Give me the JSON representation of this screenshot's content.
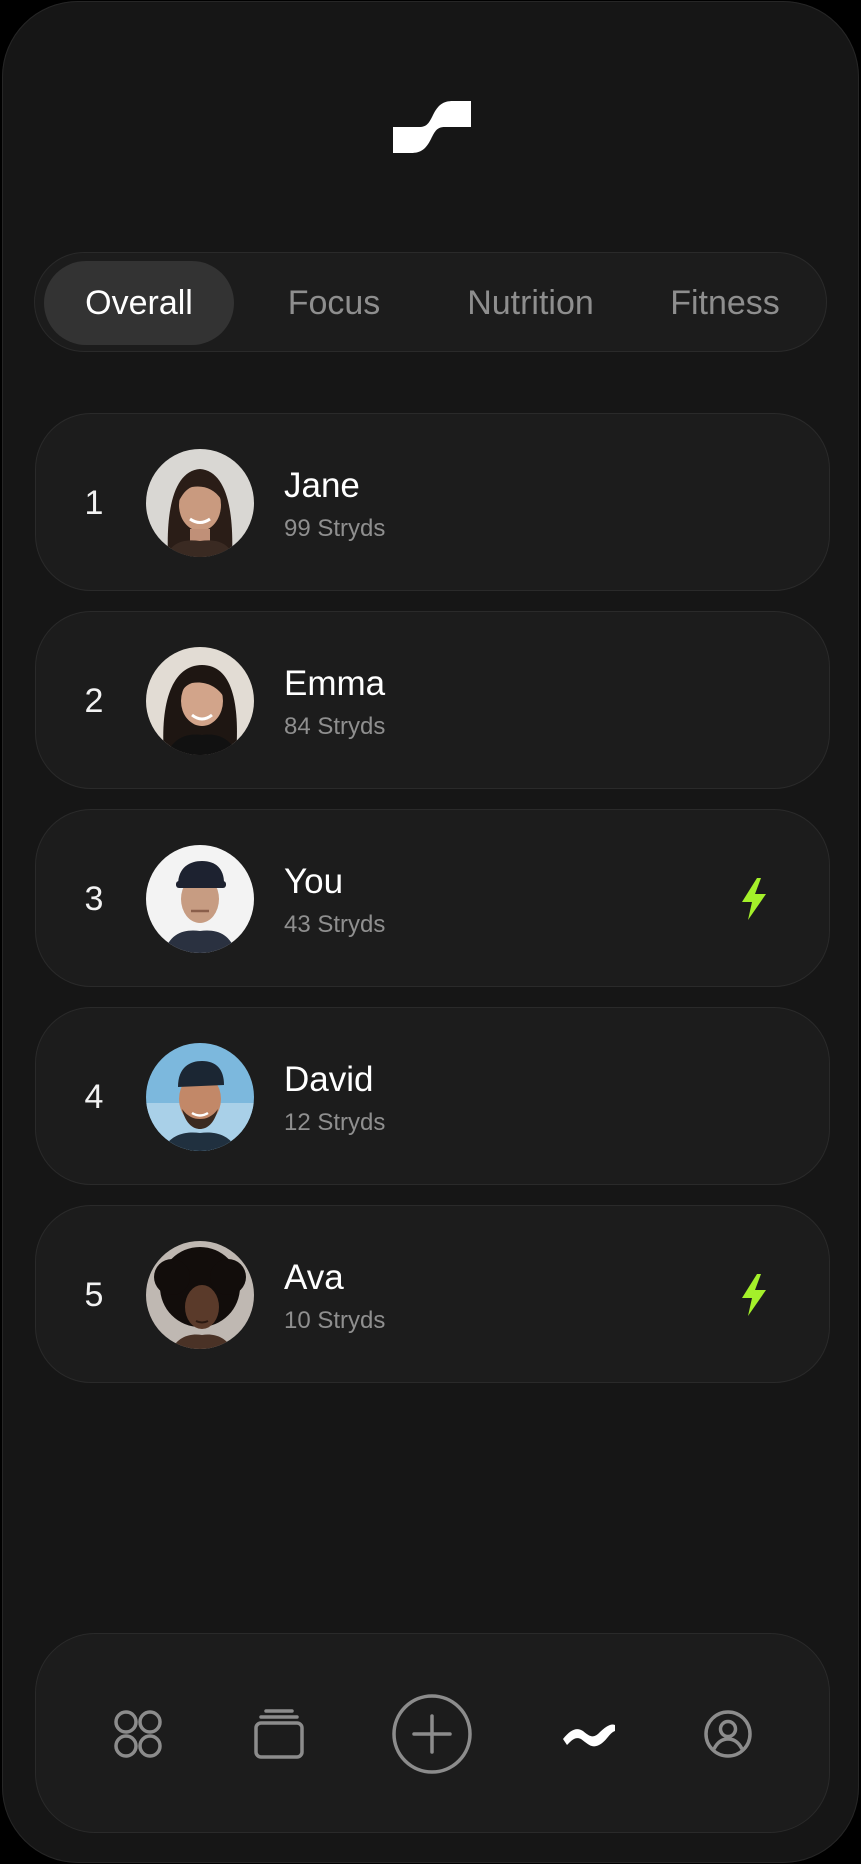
{
  "app": {
    "logo_icon": "stryd-logo-icon"
  },
  "tabs": [
    {
      "label": "Overall",
      "active": true
    },
    {
      "label": "Focus",
      "active": false
    },
    {
      "label": "Nutrition",
      "active": false
    },
    {
      "label": "Fitness",
      "active": false
    }
  ],
  "leaderboard": [
    {
      "rank": "1",
      "name": "Jane",
      "score": "99 Stryds",
      "boosted": false,
      "avatar_icon": "avatar-jane"
    },
    {
      "rank": "2",
      "name": "Emma",
      "score": "84 Stryds",
      "boosted": false,
      "avatar_icon": "avatar-emma"
    },
    {
      "rank": "3",
      "name": "You",
      "score": "43 Stryds",
      "boosted": true,
      "avatar_icon": "avatar-you"
    },
    {
      "rank": "4",
      "name": "David",
      "score": "12 Stryds",
      "boosted": false,
      "avatar_icon": "avatar-david"
    },
    {
      "rank": "5",
      "name": "Ava",
      "score": "10 Stryds",
      "boosted": true,
      "avatar_icon": "avatar-ava"
    }
  ],
  "bottom_nav": {
    "items": [
      "grid-icon",
      "stack-icon",
      "add-icon",
      "stryd-wave-icon",
      "profile-icon"
    ],
    "active": "stryd-wave-icon"
  },
  "colors": {
    "background": "#161616",
    "card": "#1c1c1c",
    "active_tab": "#333333",
    "accent_bolt": "#a4f02a",
    "muted_text": "#8f8f8f"
  }
}
